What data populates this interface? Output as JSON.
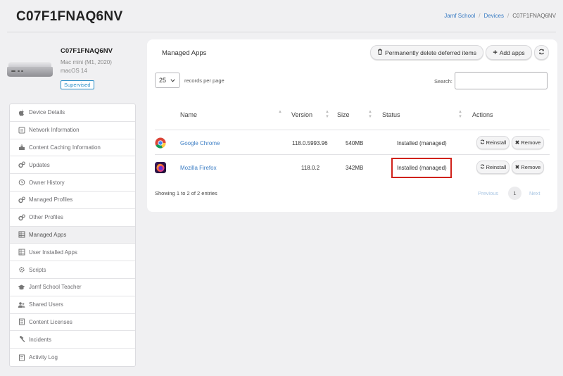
{
  "header": {
    "title": "C07F1FNAQ6NV",
    "breadcrumb": [
      "Jamf School",
      "Devices",
      "C07F1FNAQ6NV"
    ]
  },
  "device": {
    "name": "C07F1FNAQ6NV",
    "model": "Mac mini (M1, 2020)",
    "os": "macOS 14",
    "badge": "Supervised"
  },
  "sidebar": {
    "items": [
      {
        "label": "Device Details",
        "icon": "apple-icon"
      },
      {
        "label": "Network Information",
        "icon": "network-icon"
      },
      {
        "label": "Content Caching Information",
        "icon": "cache-icon"
      },
      {
        "label": "Updates",
        "icon": "gears-icon"
      },
      {
        "label": "Owner History",
        "icon": "history-icon"
      },
      {
        "label": "Managed Profiles",
        "icon": "gears-icon"
      },
      {
        "label": "Other Profiles",
        "icon": "gears-icon"
      },
      {
        "label": "Managed Apps",
        "icon": "grid-icon",
        "active": true
      },
      {
        "label": "User Installed Apps",
        "icon": "grid-icon"
      },
      {
        "label": "Scripts",
        "icon": "scripts-icon"
      },
      {
        "label": "Jamf School Teacher",
        "icon": "graduation-cap-icon"
      },
      {
        "label": "Shared Users",
        "icon": "users-icon"
      },
      {
        "label": "Content Licenses",
        "icon": "list-icon"
      },
      {
        "label": "Incidents",
        "icon": "gavel-icon"
      },
      {
        "label": "Activity Log",
        "icon": "log-icon"
      }
    ]
  },
  "panel": {
    "title": "Managed Apps",
    "delete_label": "Permanently delete deferred items",
    "add_label": "Add apps",
    "length_value": "25",
    "length_label": "records per page",
    "search_label": "Search:",
    "search_value": "",
    "columns": [
      "Name",
      "Version",
      "Size",
      "Status",
      "Actions"
    ],
    "rows": [
      {
        "name": "Google Chrome",
        "version": "118.0.5993.96",
        "size": "540MB",
        "status": "Installed (managed)",
        "icon": "chrome-icon"
      },
      {
        "name": "Mozilla Firefox",
        "version": "118.0.2",
        "size": "342MB",
        "status": "Installed (managed)",
        "icon": "firefox-icon"
      }
    ],
    "reinstall_label": "Reinstall",
    "remove_label": "Remove",
    "showing": "Showing 1 to 2 of 2 entries",
    "pagination": {
      "previous": "Previous",
      "current": "1",
      "next": "Next"
    }
  },
  "colors": {
    "accent": "#3b7dc4",
    "highlight": "#d0221b",
    "background": "#f0f0f2"
  }
}
